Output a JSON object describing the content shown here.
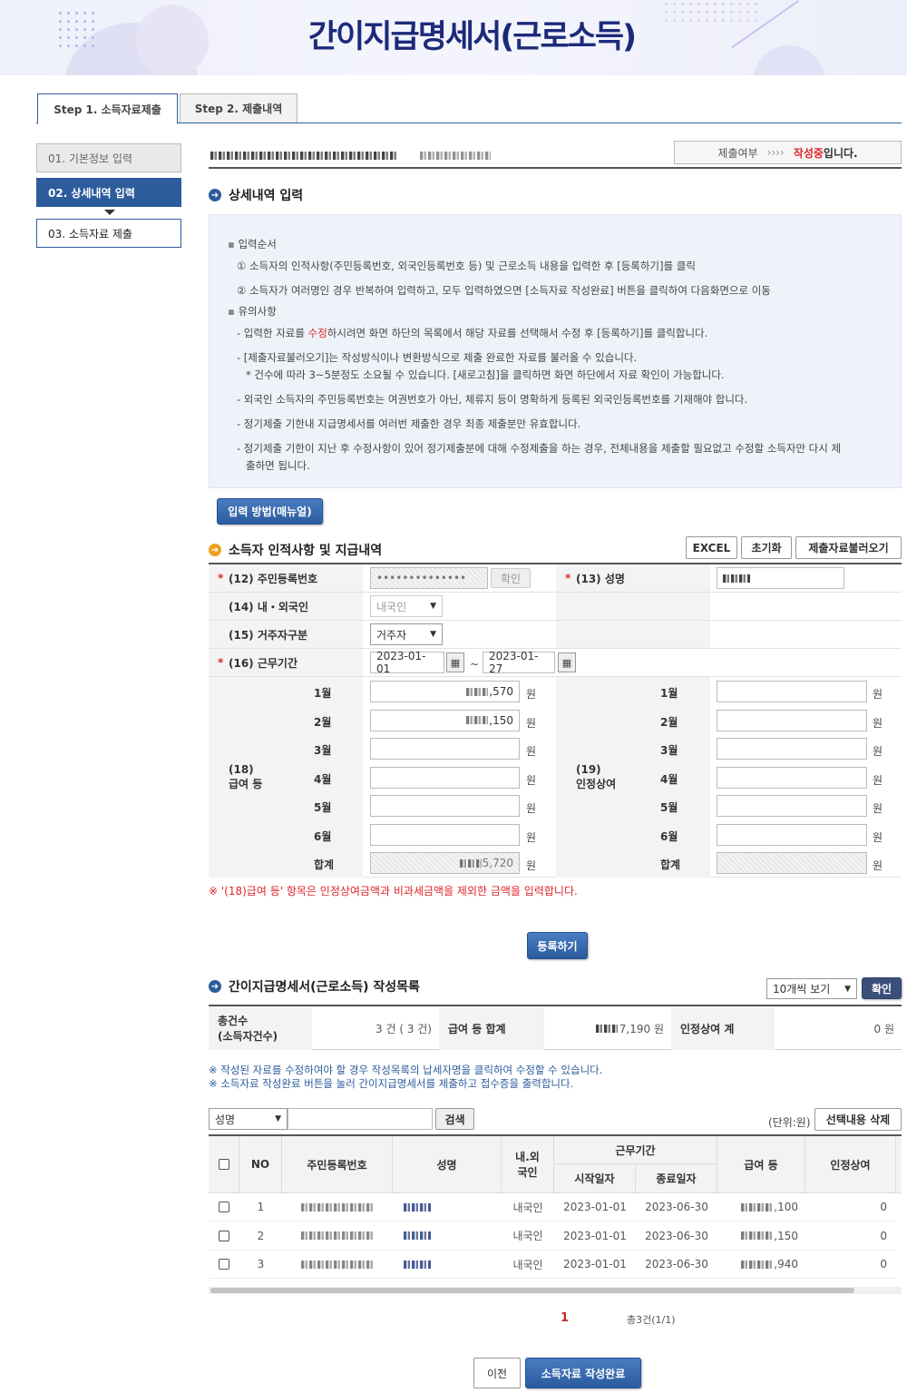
{
  "header": {
    "title": "간이지급명세서(근로소득)"
  },
  "tabs": [
    {
      "label": "Step 1. 소득자료제출"
    },
    {
      "label": "Step 2. 제출내역"
    }
  ],
  "nav": [
    {
      "label": "01. 기본정보 입력"
    },
    {
      "label": "02. 상세내역 입력"
    },
    {
      "label": "03. 소득자료 제출"
    }
  ],
  "status": {
    "label": "제출여부",
    "arrows": "››››",
    "value": "작성중",
    "suffix": "입니다."
  },
  "detail": {
    "title": "상세내역 입력"
  },
  "guide": {
    "order_title": "입력순서",
    "order1": "① 소득자의 인적사항(주민등록번호, 외국인등록번호 등) 및 근로소득 내용을 입력한 후 [등록하기]를 클릭",
    "order2": "② 소득자가 여러명인 경우 반복하여 입력하고, 모두 입력하였으면 [소득자료 작성완료] 버튼을 클릭하여 다음화면으로 이동",
    "caution_title": "유의사항",
    "c1a": "- 입력한 자료를 ",
    "c1b": "수정",
    "c1c": "하시려면 화면 하단의 목록에서 해당 자료를 선택해서 수정 후 [등록하기]를 클릭합니다.",
    "c2": "- [제출자료불러오기]는 작성방식이나 변환방식으로 제출 완료한 자료를 불러올 수 있습니다.",
    "c2b": "* 건수에 따라 3~5분정도 소요될 수 있습니다. [새로고침]을 클릭하면 화면 하단에서 자료 확인이 가능합니다.",
    "c3": "- 외국인 소득자의 주민등록번호는 여권번호가 아닌, 체류지 등이 명확하게 등록된 외국인등록번호를 기재해야 합니다.",
    "c4": "- 정기제출 기한내 지급명세서를 여러번 제출한 경우 최종 제출분만 유효합니다.",
    "c5a": "- 정기제출 기한이 지난 후 수정사항이 있어 정기제출분에 대해 수정제출을 하는 경우, 전체내용을 제출할 필요없고 수정할 소득자만 다시 제",
    "c5b": "출하면 됩니다."
  },
  "manual_button": "입력 방법(매뉴얼)",
  "form": {
    "title": "소득자 인적사항 및 지급내역",
    "excel_button": "EXCEL",
    "reset_button": "초기화",
    "load_button": "제출자료불러오기",
    "rrn_label": "(12) 주민등록번호",
    "rrn_value": "••••••••••••••",
    "confirm_button": "확인",
    "name_label": "(13) 성명",
    "nat_label": "(14) 내・외국인",
    "nat_value": "내국인",
    "res_label": "(15) 거주자구분",
    "res_value": "거주자",
    "period_label": "(16) 근무기간",
    "period_start": "2023-01-01",
    "period_sep": "~",
    "period_end": "2023-01-27",
    "salary_label_a": "(18)",
    "salary_label_b": "급여 등",
    "bonus_label_a": "(19)",
    "bonus_label_b": "인정상여",
    "months": [
      "1월",
      "2월",
      "3월",
      "4월",
      "5월",
      "6월",
      "합계"
    ],
    "salary_values": [
      ",570",
      ",150",
      "",
      "",
      "",
      "",
      "5,720"
    ],
    "unit": "원",
    "note": "※ '(18)급여 등' 항목은 인정상여금액과 비과세금액을 제외한 금액을 입력합니다."
  },
  "register_button": "등록하기",
  "list": {
    "title": "간이지급명세서(근로소득) 작성목록",
    "page_size": "10개씩 보기",
    "confirm_button": "확인",
    "total_label_a": "총건수",
    "total_label_b": "(소득자건수)",
    "total_value": "3 건 ( 3 건)",
    "salary_sum_label": "급여 등 합계",
    "salary_sum_value": "7,190 원",
    "bonus_sum_label": "인정상여 계",
    "bonus_sum_value": "0 원",
    "note1": "※ 작성된 자료를 수정하여야 할 경우 작성목록의 납세자명을 클릭하여 수정할 수 있습니다.",
    "note2": "※ 소득자료 작성완료 버튼을 눌러 간이지급명세서를 제출하고 접수증을 출력합니다.",
    "search_field": "성명",
    "search_button": "검색",
    "unit_label": "(단위:원)",
    "delete_button": "선택내용 삭제",
    "headers": {
      "no": "NO",
      "rrn": "주민등록번호",
      "name": "성명",
      "nat_a": "내.외",
      "nat_b": "국인",
      "period": "근무기간",
      "start": "시작일자",
      "end": "종료일자",
      "salary": "급여 등",
      "bonus": "인정상여"
    },
    "rows": [
      {
        "no": "1",
        "nat": "내국인",
        "start": "2023-01-01",
        "end": "2023-06-30",
        "salary": ",100",
        "bonus": "0"
      },
      {
        "no": "2",
        "nat": "내국인",
        "start": "2023-01-01",
        "end": "2023-06-30",
        "salary": ",150",
        "bonus": "0"
      },
      {
        "no": "3",
        "nat": "내국인",
        "start": "2023-01-01",
        "end": "2023-06-30",
        "salary": ",940",
        "bonus": "0"
      }
    ],
    "page_current": "1",
    "page_total": "총3건(1/1)"
  },
  "footer": {
    "prev_button": "이전",
    "complete_button": "소득자료 작성완료"
  }
}
